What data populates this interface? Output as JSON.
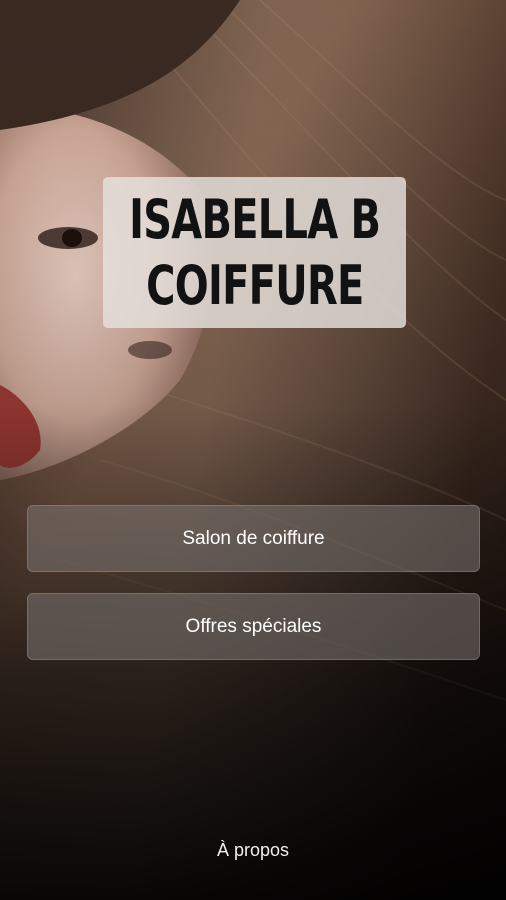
{
  "header": {
    "logo_line1": "ISABELLA B",
    "logo_line2": "COIFFURE"
  },
  "menu": {
    "salon_label": "Salon de coiffure",
    "offers_label": "Offres spéciales"
  },
  "footer": {
    "about_label": "À propos"
  },
  "colors": {
    "background": "#0e0b0a",
    "hair_brown": "#5a3d2b",
    "button_fill": "#7a726e",
    "text_light": "#ffffff"
  }
}
